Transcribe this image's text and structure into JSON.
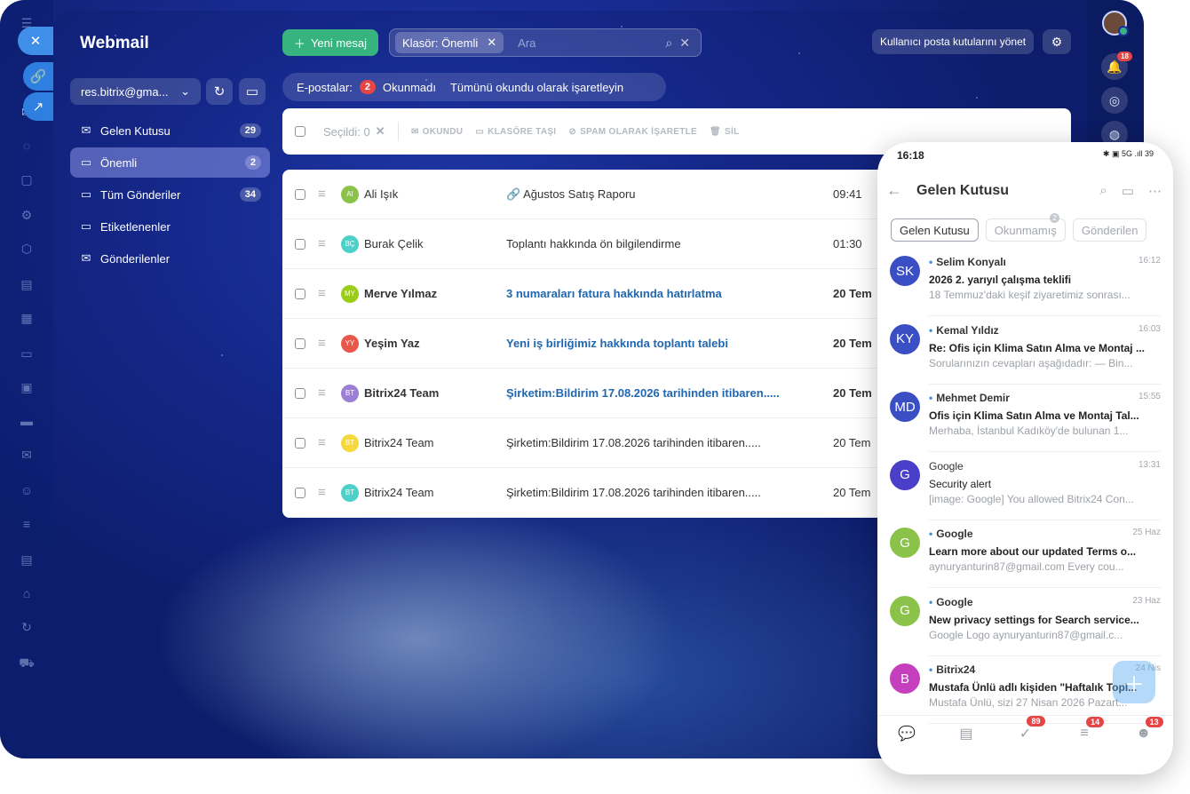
{
  "app": {
    "title": "Webmail"
  },
  "account": {
    "email": "res.bitrix@gma..."
  },
  "folders": [
    {
      "name": "Gelen Kutusu",
      "count": "29",
      "icon": "inbox-icon",
      "active": false
    },
    {
      "name": "Önemli",
      "count": "2",
      "icon": "folder-icon",
      "active": true
    },
    {
      "name": "Tüm Gönderiler",
      "count": "34",
      "icon": "folder-icon",
      "active": false
    },
    {
      "name": "Etiketlenenler",
      "count": "",
      "icon": "folder-icon",
      "active": false
    },
    {
      "name": "Gönderilenler",
      "count": "",
      "icon": "sent-icon",
      "active": false
    }
  ],
  "toolbar": {
    "new_message": "Yeni mesaj",
    "filter_chip": "Klasör: Önemli",
    "search_placeholder": "Ara",
    "manage_label": "Kullanıcı posta kutularını yönet"
  },
  "filterbar": {
    "label": "E-postalar:",
    "unread_count": "2",
    "unread_label": "Okunmadı",
    "mark_all": "Tümünü okundu olarak işaretleyin"
  },
  "actions": {
    "selected": "Seçildi: 0",
    "read": "OKUNDU",
    "move": "KLASÖRE TAŞI",
    "spam": "SPAM OLARAK İŞARETLE",
    "delete": "SİL"
  },
  "mails": [
    {
      "initials": "AI",
      "color": "#8bc34a",
      "sender": "Ali Işık",
      "subject": "🔗 Ağustos Satış Raporu",
      "time": "09:41",
      "unread": false
    },
    {
      "initials": "BÇ",
      "color": "#4dd0c8",
      "sender": "Burak Çelik",
      "subject": "Toplantı hakkında ön bilgilendirme",
      "time": "01:30",
      "unread": false
    },
    {
      "initials": "MY",
      "color": "#9ccc1a",
      "sender": "Merve Yılmaz",
      "subject": "3 numaraları fatura hakkında hatırlatma",
      "time": "20 Tem",
      "unread": true
    },
    {
      "initials": "YY",
      "color": "#e8574a",
      "sender": "Yeşim Yaz",
      "subject": "Yeni iş birliğimiz hakkında toplantı talebi",
      "time": "20 Tem",
      "unread": true
    },
    {
      "initials": "BT",
      "color": "#9b7fd6",
      "sender": "Bitrix24 Team",
      "subject": "Şirketim:Bildirim 17.08.2026 tarihinden itibaren.....",
      "time": "20 Tem",
      "unread": true
    },
    {
      "initials": "BT",
      "color": "#f5d83b",
      "sender": "Bitrix24 Team",
      "subject": "Şirketim:Bildirim 17.08.2026 tarihinden itibaren.....",
      "time": "20 Tem",
      "unread": false
    },
    {
      "initials": "BT",
      "color": "#4dd0c8",
      "sender": "Bitrix24 Team",
      "subject": "Şirketim:Bildirim 17.08.2026 tarihinden itibaren.....",
      "time": "20 Tem",
      "unread": false
    }
  ],
  "right_rail": {
    "notif_count": "18"
  },
  "phone": {
    "status_time": "16:18",
    "status_icons": "✱ ▣ 5G .ıll 39",
    "title": "Gelen Kutusu",
    "tabs": [
      {
        "label": "Gelen Kutusu",
        "badge": "",
        "active": true
      },
      {
        "label": "Okunmamış",
        "badge": "2",
        "active": false
      },
      {
        "label": "Gönderilen",
        "badge": "",
        "active": false
      }
    ],
    "mails": [
      {
        "initials": "SK",
        "color": "#3b4fc4",
        "name": "Selim Konyalı",
        "time": "16:12",
        "subject": "2026 2. yarıyıl çalışma teklifi",
        "preview": "18 Temmuz'daki keşif ziyaretimiz sonrası...",
        "unread": true
      },
      {
        "initials": "KY",
        "color": "#3b4fc4",
        "name": "Kemal Yıldız",
        "time": "16:03",
        "subject": "Re: Ofis için Klima Satın Alma ve Montaj ...",
        "preview": "Sorularınızın cevapları aşağıdadır:  — Bin...",
        "unread": true
      },
      {
        "initials": "MD",
        "color": "#3b4fc4",
        "name": "Mehmet Demir",
        "time": "15:55",
        "subject": "Ofis için Klima Satın Alma ve Montaj Tal...",
        "preview": "Merhaba,   İstanbul Kadıköy'de bulunan 1...",
        "unread": true
      },
      {
        "initials": "G",
        "color": "#4a3fc8",
        "name": "Google",
        "time": "13:31",
        "subject": "Security alert",
        "preview": "[image: Google] You allowed Bitrix24 Con...",
        "unread": false
      },
      {
        "initials": "G",
        "color": "#8bc34a",
        "name": "Google",
        "time": "25 Haz",
        "subject": "Learn more about our updated Terms o...",
        "preview": "aynuryanturin87@gmail.com Every cou...",
        "unread": true
      },
      {
        "initials": "G",
        "color": "#8bc34a",
        "name": "Google",
        "time": "23 Haz",
        "subject": "New privacy settings for Search service...",
        "preview": "Google Logo  aynuryanturin87@gmail.c...",
        "unread": true
      },
      {
        "initials": "B",
        "color": "#c63fbf",
        "name": "Bitrix24",
        "time": "24 Nis",
        "subject": "Mustafa Ünlü adlı kişiden \"Haftalık Topl...",
        "preview": "Mustafa Ünlü, sizi 27 Nisan 2026 Pazart...",
        "unread": true
      }
    ],
    "nav": [
      {
        "icon": "chat-icon",
        "glyph": "💬",
        "badge": ""
      },
      {
        "icon": "document-icon",
        "glyph": "▤",
        "badge": ""
      },
      {
        "icon": "tasks-icon",
        "glyph": "✓",
        "badge": "89"
      },
      {
        "icon": "feed-icon",
        "glyph": "≡",
        "badge": "14"
      },
      {
        "icon": "profile-icon",
        "glyph": "☻",
        "badge": "13"
      }
    ]
  },
  "colors": {
    "accent_green": "#36b37e",
    "badge_red": "#e64545",
    "link_blue": "#2067b0"
  }
}
